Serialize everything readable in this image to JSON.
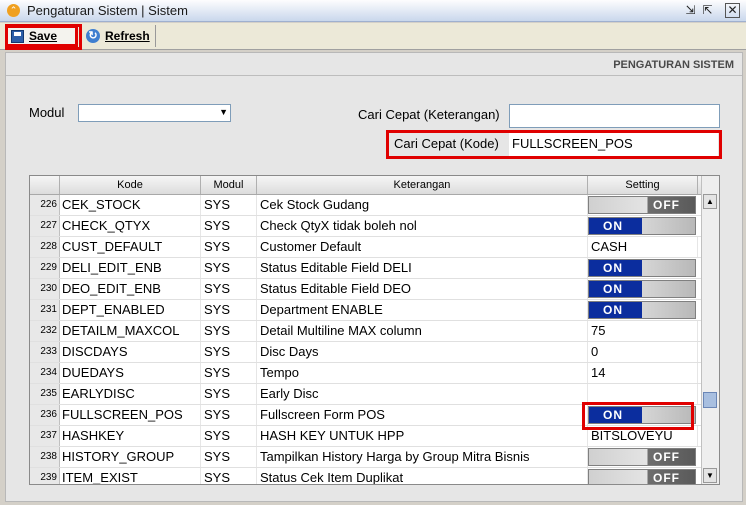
{
  "window": {
    "title": "Pengaturan Sistem | Sistem",
    "logo_glyph": "⌃",
    "controls": [
      "⇲",
      "⇱",
      "✕"
    ]
  },
  "toolbar": {
    "save_label": "Save",
    "refresh_label": "Refresh",
    "refresh_glyph": "↻"
  },
  "page": {
    "section_title": "PENGATURAN SISTEM"
  },
  "filters": {
    "modul_label": "Modul",
    "modul_value": "",
    "cari_ket_label": "Cari Cepat (Keterangan)",
    "cari_ket_value": "",
    "cari_kode_label": "Cari Cepat (Kode)",
    "cari_kode_value": "FULLSCREEN_POS"
  },
  "grid": {
    "columns": [
      "Kode",
      "Modul",
      "Keterangan",
      "Setting"
    ],
    "rows": [
      {
        "no": "226",
        "kode": "CEK_STOCK",
        "modul": "SYS",
        "ket": "Cek Stock Gudang",
        "setting": "OFF",
        "toggle": "off"
      },
      {
        "no": "227",
        "kode": "CHECK_QTYX",
        "modul": "SYS",
        "ket": "Check QtyX tidak boleh nol",
        "setting": "ON",
        "toggle": "on"
      },
      {
        "no": "228",
        "kode": "CUST_DEFAULT",
        "modul": "SYS",
        "ket": "Customer Default",
        "setting": "CASH",
        "toggle": ""
      },
      {
        "no": "229",
        "kode": "DELI_EDIT_ENB",
        "modul": "SYS",
        "ket": "Status Editable Field DELI",
        "setting": "ON",
        "toggle": "on"
      },
      {
        "no": "230",
        "kode": "DEO_EDIT_ENB",
        "modul": "SYS",
        "ket": "Status Editable Field DEO",
        "setting": "ON",
        "toggle": "on"
      },
      {
        "no": "231",
        "kode": "DEPT_ENABLED",
        "modul": "SYS",
        "ket": "Department ENABLE",
        "setting": "ON",
        "toggle": "on"
      },
      {
        "no": "232",
        "kode": "DETAILM_MAXCOL",
        "modul": "SYS",
        "ket": "Detail Multiline MAX column",
        "setting": "75",
        "toggle": ""
      },
      {
        "no": "233",
        "kode": "DISCDAYS",
        "modul": "SYS",
        "ket": "Disc Days",
        "setting": "0",
        "toggle": ""
      },
      {
        "no": "234",
        "kode": "DUEDAYS",
        "modul": "SYS",
        "ket": "Tempo",
        "setting": "14",
        "toggle": ""
      },
      {
        "no": "235",
        "kode": "EARLYDISC",
        "modul": "SYS",
        "ket": "Early Disc",
        "setting": "",
        "toggle": ""
      },
      {
        "no": "236",
        "kode": "FULLSCREEN_POS",
        "modul": "SYS",
        "ket": "Fullscreen Form POS",
        "setting": "ON",
        "toggle": "on"
      },
      {
        "no": "237",
        "kode": "HASHKEY",
        "modul": "SYS",
        "ket": "HASH KEY UNTUK HPP",
        "setting": "BITSLOVEYU",
        "toggle": ""
      },
      {
        "no": "238",
        "kode": "HISTORY_GROUP",
        "modul": "SYS",
        "ket": "Tampilkan History Harga by Group Mitra Bisnis",
        "setting": "OFF",
        "toggle": "off"
      },
      {
        "no": "239",
        "kode": "ITEM_EXIST",
        "modul": "SYS",
        "ket": "Status Cek Item Duplikat",
        "setting": "OFF",
        "toggle": "off"
      }
    ]
  },
  "scroll": {
    "up_glyph": "▲",
    "down_glyph": "▼"
  }
}
